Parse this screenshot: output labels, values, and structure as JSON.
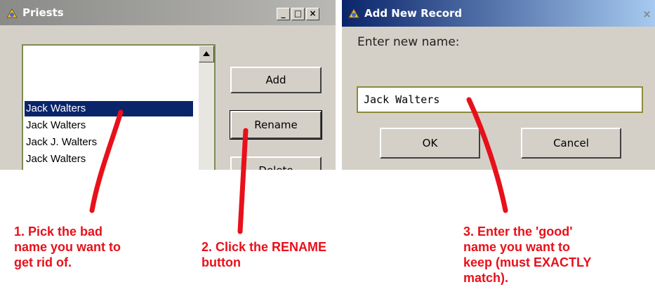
{
  "priests_window": {
    "title": "Priests",
    "caption_buttons": {
      "minimize": "_",
      "maximize": "□",
      "close": "×"
    },
    "list_items": [
      "Jack  Walters",
      "Jack  Walters",
      "Jack J. Walters",
      "Jack Walters"
    ],
    "selected_index": 0,
    "buttons": {
      "add": "Add",
      "rename": "Rename",
      "delete": "Delete"
    }
  },
  "add_window": {
    "title": "Add New Record",
    "prompt": "Enter new name:",
    "name_value": "Jack Walters",
    "ok_label": "OK",
    "cancel_label": "Cancel",
    "close": "×"
  },
  "annotations": {
    "step1": "1.  Pick the bad\nname you want to\nget rid of.",
    "step2": "2.  Click the RENAME\nbutton",
    "step3": "3.  Enter the 'good'\nname you want to\nkeep (must EXACTLY\nmatch)."
  },
  "colors": {
    "annotation_red": "#e8101a",
    "selection": "#0a246a",
    "active_title": "#0a246a"
  },
  "icons": {
    "app_icon": "wrench-pencil-icon",
    "scroll_up": "triangle-up-icon"
  }
}
